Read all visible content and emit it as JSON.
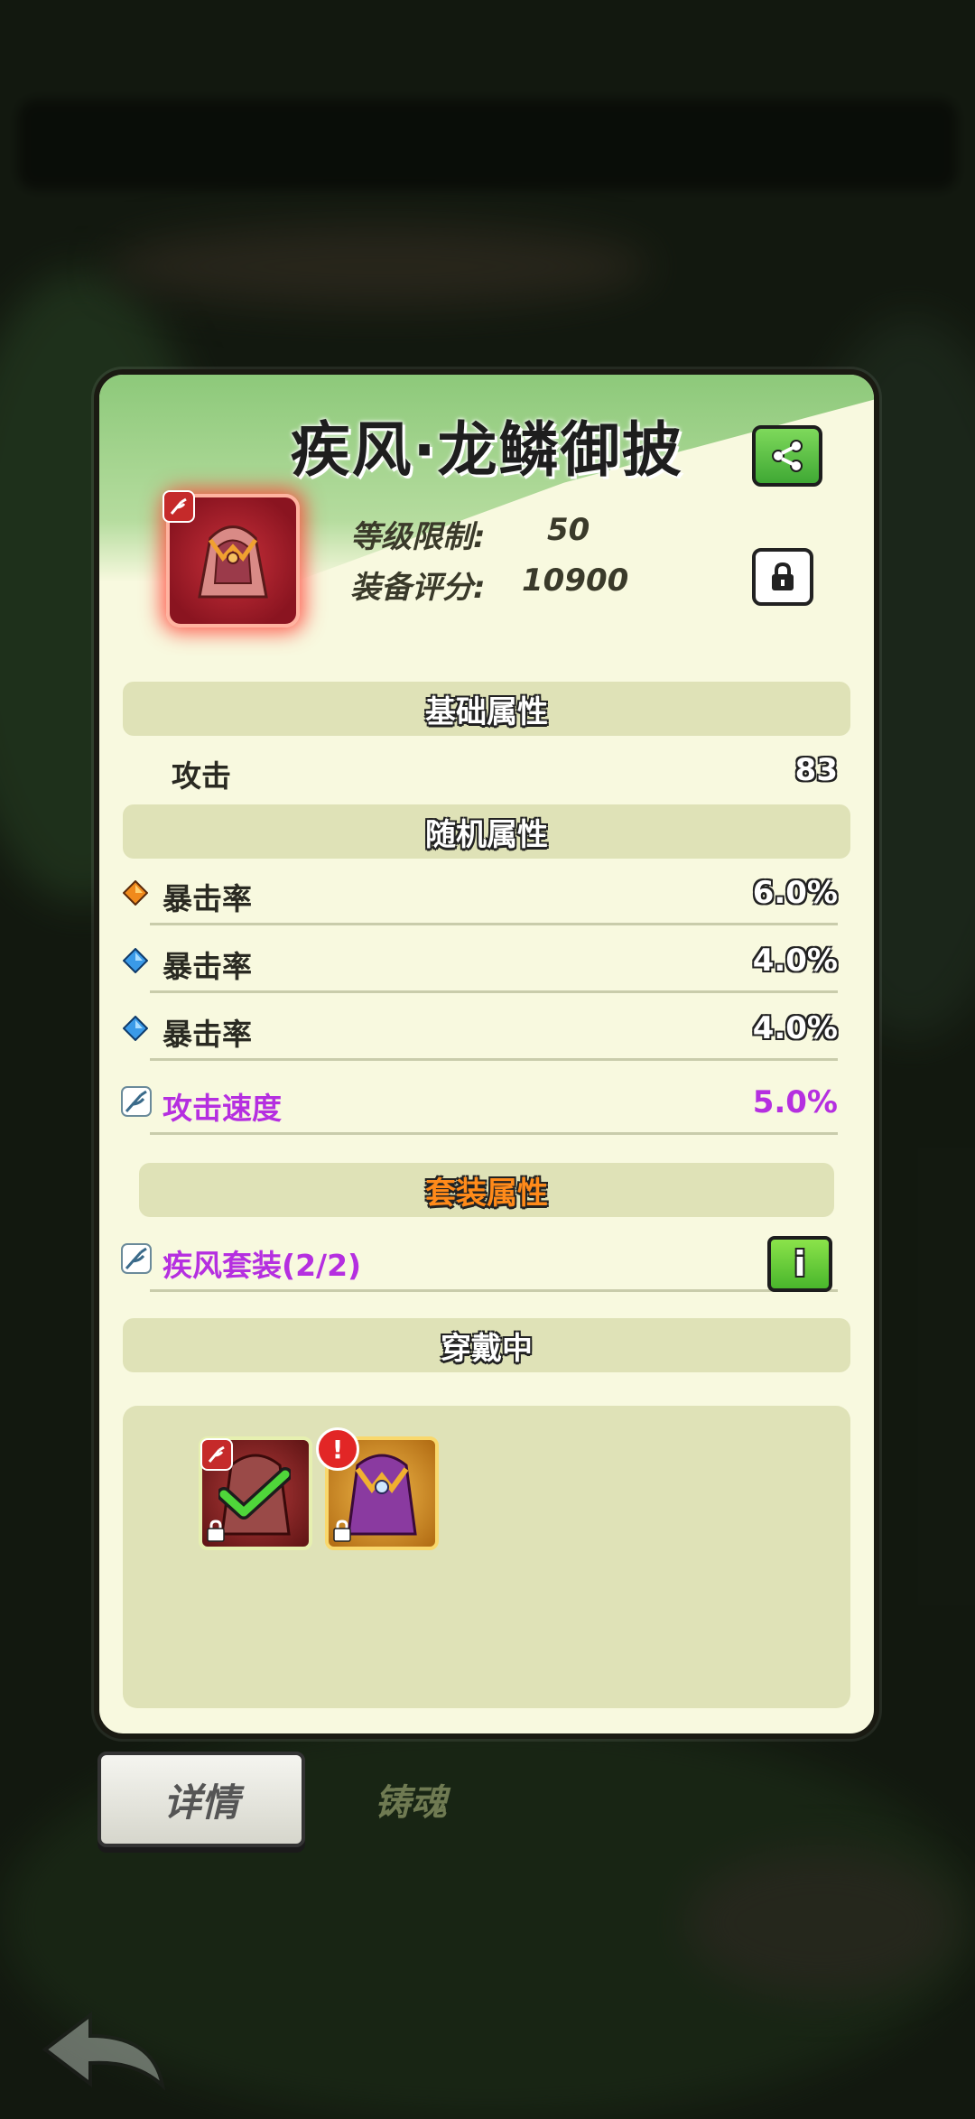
{
  "item": {
    "name": "疾风·龙鳞御披",
    "level_limit_label": "等级限制:",
    "level_limit_value": "50",
    "score_label": "装备评分:",
    "score_value": "10900"
  },
  "sections": {
    "base": "基础属性",
    "random": "随机属性",
    "set": "套装属性",
    "equipped": "穿戴中"
  },
  "base_attrs": [
    {
      "name": "攻击",
      "value": "83"
    }
  ],
  "random_attrs": [
    {
      "name": "暴击率",
      "value": "6.0%",
      "gem": "orange-gem-icon"
    },
    {
      "name": "暴击率",
      "value": "4.0%",
      "gem": "blue-gem-icon"
    },
    {
      "name": "暴击率",
      "value": "4.0%",
      "gem": "blue-gem-icon"
    },
    {
      "name": "攻击速度",
      "value": "5.0%",
      "gem": "wind-set-icon"
    }
  ],
  "set_bonus": {
    "name": "疾风套装(2/2)",
    "info": "i"
  },
  "equipped_slots": [
    {
      "rarity": "red",
      "state": "equipped"
    },
    {
      "rarity": "gold",
      "state": "alert",
      "badge": "!"
    }
  ],
  "tabs": {
    "details": "详情",
    "soul": "铸魂"
  },
  "colors": {
    "accent_green": "#49b62c",
    "purple_text": "#b52fe0",
    "panel_bg": "#f8f9df",
    "section_bg": "#dfe2b7"
  }
}
